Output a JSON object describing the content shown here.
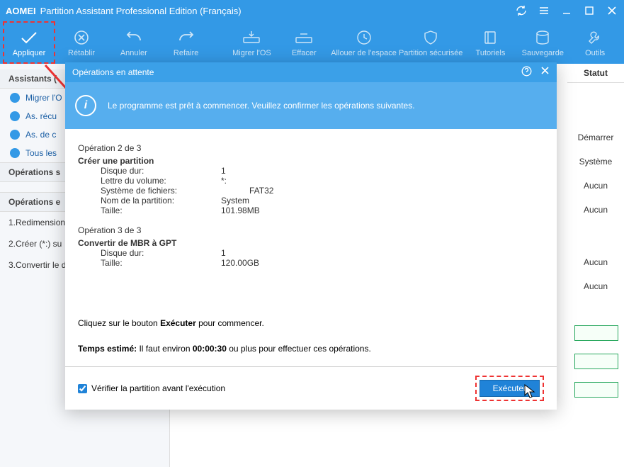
{
  "titlebar": {
    "brand": "AOMEI",
    "product": "Partition Assistant Professional Edition (Français)"
  },
  "toolbar": [
    {
      "id": "apply",
      "label": "Appliquer"
    },
    {
      "id": "restore",
      "label": "Rétablir"
    },
    {
      "id": "undo",
      "label": "Annuler"
    },
    {
      "id": "redo",
      "label": "Refaire"
    },
    {
      "id": "migrate",
      "label": "Migrer l'OS"
    },
    {
      "id": "wipe",
      "label": "Effacer"
    },
    {
      "id": "allocate",
      "label": "Allouer de l'espace"
    },
    {
      "id": "secure",
      "label": "Partition sécurisée"
    },
    {
      "id": "tutorials",
      "label": "Tutoriels"
    },
    {
      "id": "backup",
      "label": "Sauvegarde"
    },
    {
      "id": "tools",
      "label": "Outils"
    }
  ],
  "sidebar": {
    "assistants_header": "Assistants (",
    "assistants": [
      {
        "label": "Migrer l'O"
      },
      {
        "label": "As. récu"
      },
      {
        "label": "As. de c"
      },
      {
        "label": "Tous les"
      }
    ],
    "ops_header": "Opérations s",
    "pending_header": "Opérations e",
    "pending": [
      {
        "label": "1.Redimension"
      },
      {
        "label": "2.Créer (*:) su"
      },
      {
        "label": "3.Convertir le d"
      }
    ]
  },
  "right": {
    "header": "Statut",
    "rows": [
      "Démarrer",
      "Système",
      "Aucun",
      "Aucun",
      "Aucun",
      "Aucun"
    ]
  },
  "dialog": {
    "title": "Opérations en attente",
    "info": "Le programme est prêt à commencer. Veuillez confirmer les opérations suivantes.",
    "ops": [
      {
        "num": "Opération 2 de 3",
        "head": "Créer une partition",
        "kv": [
          {
            "k": "Disque dur:",
            "v": "1"
          },
          {
            "k": "Lettre du volume:",
            "v": "*:"
          },
          {
            "k": "Système de fichiers:",
            "v": "FAT32"
          },
          {
            "k": "Nom de la partition:",
            "v": "System"
          },
          {
            "k": "Taille:",
            "v": "101.98MB"
          }
        ]
      },
      {
        "num": "Opération 3 de 3",
        "head": "Convertir de MBR à GPT",
        "kv": [
          {
            "k": "Disque dur:",
            "v": "1"
          },
          {
            "k": "Taille:",
            "v": "120.00GB"
          }
        ]
      }
    ],
    "note_pre": "Cliquez sur le bouton ",
    "note_bold": "Exécuter",
    "note_post": " pour commencer.",
    "eta_label": "Temps estimé:",
    "eta_mid": " Il faut environ ",
    "eta_time": "00:00:30",
    "eta_post": " ou plus pour effectuer ces opérations.",
    "verify": "Vérifier la partition avant l'exécution",
    "execute": "Exécuter"
  }
}
